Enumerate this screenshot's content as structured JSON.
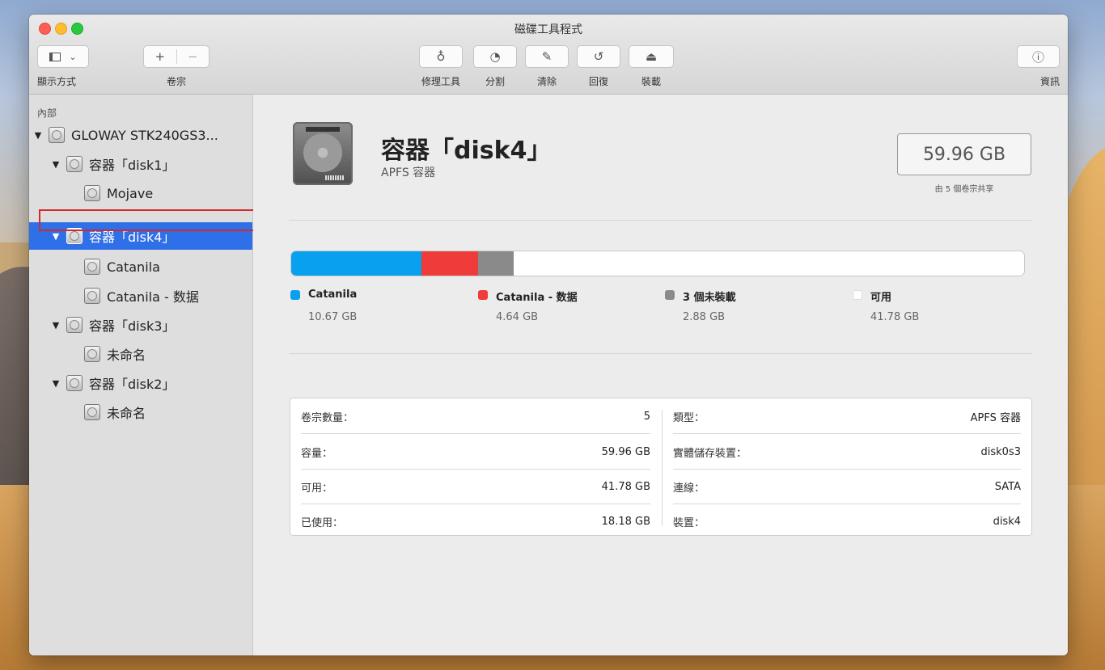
{
  "window": {
    "title": "磁碟工具程式"
  },
  "toolbar": {
    "view_label": "顯示方式",
    "volume_label": "卷宗",
    "firstaid_label": "修理工具",
    "partition_label": "分割",
    "erase_label": "清除",
    "restore_label": "回復",
    "mount_label": "裝載",
    "info_label": "資訊"
  },
  "sidebar": {
    "section": "內部",
    "items": [
      {
        "label": "GLOWAY STK240GS3..."
      },
      {
        "label": "容器「disk1」"
      },
      {
        "label": "Mojave"
      },
      {
        "label": "容器「disk4」"
      },
      {
        "label": "Catanila"
      },
      {
        "label": "Catanila - 数据"
      },
      {
        "label": "容器「disk3」"
      },
      {
        "label": "未命名"
      },
      {
        "label": "容器「disk2」"
      },
      {
        "label": "未命名"
      }
    ]
  },
  "header": {
    "title": "容器「disk4」",
    "subtitle": "APFS 容器",
    "capacity": "59.96 GB",
    "capacity_note": "由 5 個卷宗共享"
  },
  "usage": {
    "segments": [
      {
        "name": "Catanila",
        "value": "10.67 GB",
        "gb": 10.67,
        "color": "#0aa0f0"
      },
      {
        "name": "Catanila - 数据",
        "value": "4.64 GB",
        "gb": 4.64,
        "color": "#f03b3b"
      },
      {
        "name": "3 個未裝載",
        "value": "2.88 GB",
        "gb": 2.88,
        "color": "#8a8a8a"
      },
      {
        "name": "可用",
        "value": "41.78 GB",
        "gb": 41.78,
        "color": "#ffffff"
      }
    ],
    "total_gb": 59.96
  },
  "info": {
    "left": [
      {
        "k": "卷宗數量：",
        "v": "5"
      },
      {
        "k": "容量：",
        "v": "59.96 GB"
      },
      {
        "k": "可用：",
        "v": "41.78 GB"
      },
      {
        "k": "已使用：",
        "v": "18.18 GB"
      }
    ],
    "right": [
      {
        "k": "類型：",
        "v": "APFS 容器"
      },
      {
        "k": "實體儲存裝置：",
        "v": "disk0s3"
      },
      {
        "k": "連線：",
        "v": "SATA"
      },
      {
        "k": "裝置：",
        "v": "disk4"
      }
    ]
  }
}
